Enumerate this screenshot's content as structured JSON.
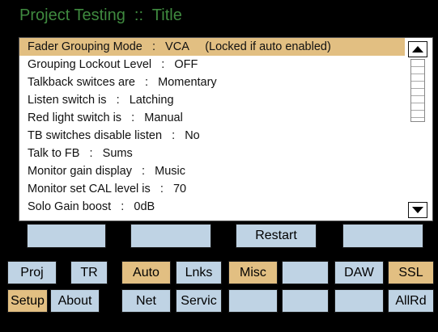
{
  "title": "Project Testing  ::  Title",
  "settings": [
    "Fader Grouping Mode   :   VCA     (Locked if auto enabled)",
    "Grouping Lockout Level   :   OFF",
    "Talkback switces are   :   Momentary",
    "Listen switch is   :   Latching",
    "Red light switch is   :   Manual",
    "TB switches disable listen   :   No",
    "Talk to FB   :   Sums",
    "Monitor gain display   :   Music",
    "Monitor set CAL level is   :   70",
    "Solo Gain boost   :   0dB"
  ],
  "action_row": [
    "",
    "",
    "Restart",
    ""
  ],
  "tabs_row1": [
    "Proj",
    "TR",
    "Auto",
    "Lnks",
    "Misc",
    "",
    "DAW",
    "SSL"
  ],
  "tabs_row2": [
    "Setup",
    "About",
    "Net",
    "Servic",
    "",
    "",
    "",
    "AllRd"
  ],
  "icons": {
    "scroll_up": "arrow-up-icon",
    "scroll_down": "arrow-down-icon"
  },
  "colors": {
    "background": "#000000",
    "title": "#3f8a3f",
    "button": "#bfd3e4",
    "highlight": "#e2bf82"
  }
}
